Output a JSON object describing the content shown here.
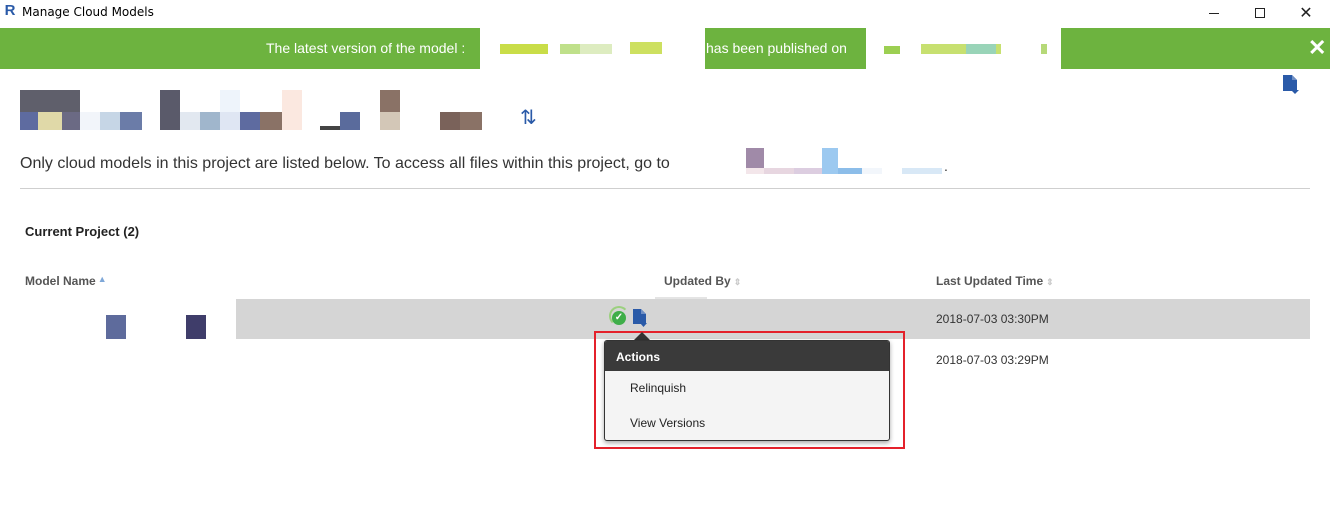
{
  "window": {
    "title": "Manage Cloud Models",
    "app_icon": "revit-R-icon",
    "controls": [
      "minimize-icon",
      "maximize-icon",
      "close-icon"
    ]
  },
  "banner": {
    "text_before": "The latest version of the model :",
    "text_after": "has been published on",
    "close_icon": "close-icon",
    "color": "#6db33f"
  },
  "header": {
    "publish_icon": "document-download-icon",
    "refresh_icon": "refresh-icon",
    "info_text": "Only cloud models in this project are listed below. To access all files within this project, go to",
    "info_suffix": "."
  },
  "section": {
    "title": "Current Project (2)"
  },
  "table": {
    "columns": [
      {
        "label": "Model Name",
        "sort": "ascending"
      },
      {
        "label": "Updated By",
        "sort": "none"
      },
      {
        "label": "Last Updated Time",
        "sort": "none"
      }
    ],
    "rows": [
      {
        "last_updated": "2018-07-03 03:30PM",
        "status_icon": "check-circle-icon",
        "action_icon": "document-download-icon",
        "selected": true
      },
      {
        "last_updated": "2018-07-03 03:29PM",
        "selected": false
      }
    ]
  },
  "actions_menu": {
    "title": "Actions",
    "items": [
      "Relinquish",
      "View Versions"
    ],
    "highlight_color": "#e4212b"
  }
}
